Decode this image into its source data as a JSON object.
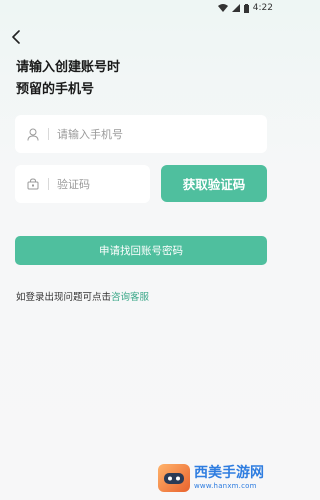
{
  "status_bar": {
    "time": "4:22"
  },
  "header": {
    "title_line1": "请输入创建账号时",
    "title_line2": "预留的手机号"
  },
  "form": {
    "phone_placeholder": "请输入手机号",
    "code_placeholder": "验证码",
    "get_code_label": "获取验证码",
    "submit_label": "申请找回账号密码"
  },
  "help": {
    "prefix": "如登录出现问题可点击",
    "link": "咨询客服"
  },
  "watermark": {
    "brand": "西美手游网",
    "url": "www.hanxm.com"
  },
  "colors": {
    "accent": "#4fbf9e",
    "link": "#3aa788",
    "background": "#f7f7f8"
  }
}
